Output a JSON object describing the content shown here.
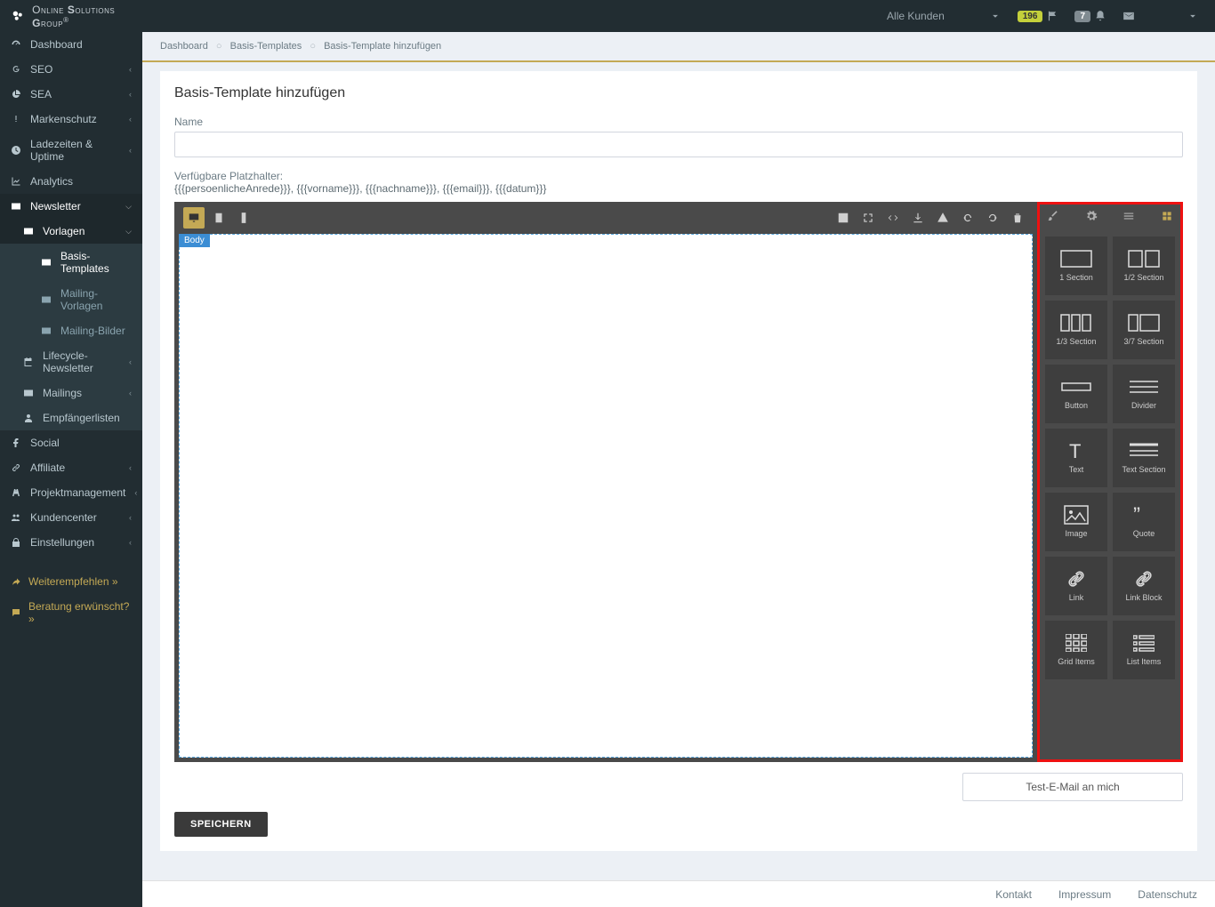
{
  "brand": {
    "name_html": "Online Solutions Group",
    "sup": "®"
  },
  "topbar": {
    "customer_label": "Alle Kunden",
    "badge1": "196",
    "badge2": "7"
  },
  "sidebar": {
    "items": [
      {
        "icon": "tach",
        "label": "Dashboard"
      },
      {
        "icon": "g",
        "label": "SEO",
        "chev": true
      },
      {
        "icon": "pie",
        "label": "SEA",
        "chev": true
      },
      {
        "icon": "excl",
        "label": "Markenschutz",
        "chev": true
      },
      {
        "icon": "clock",
        "label": "Ladezeiten & Uptime",
        "chev": true
      },
      {
        "icon": "chart",
        "label": "Analytics"
      },
      {
        "icon": "mail",
        "label": "Newsletter",
        "chev": true,
        "open": true
      },
      {
        "icon": "fb",
        "label": "Social"
      },
      {
        "icon": "link",
        "label": "Affiliate",
        "chev": true
      },
      {
        "icon": "road",
        "label": "Projektmanagement",
        "chev": true
      },
      {
        "icon": "users",
        "label": "Kundencenter",
        "chev": true
      },
      {
        "icon": "lock",
        "label": "Einstellungen",
        "chev": true
      }
    ],
    "newsletter_sub": [
      {
        "icon": "mail",
        "label": "Vorlagen",
        "chev": true,
        "open": true
      },
      {
        "icon": "cal",
        "label": "Lifecycle-Newsletter",
        "chev": true
      },
      {
        "icon": "mail",
        "label": "Mailings",
        "chev": true
      },
      {
        "icon": "user",
        "label": "Empfängerlisten"
      }
    ],
    "vorlagen_sub": [
      {
        "icon": "mail",
        "label": "Basis-Templates",
        "sel": true
      },
      {
        "icon": "mail",
        "label": "Mailing-Vorlagen"
      },
      {
        "icon": "mail",
        "label": "Mailing-Bilder"
      }
    ],
    "extra": [
      {
        "icon": "share",
        "label": "Weiterempfehlen »"
      },
      {
        "icon": "comment",
        "label": "Beratung erwünscht? »"
      }
    ]
  },
  "breadcrumb": [
    "Dashboard",
    "Basis-Templates",
    "Basis-Template hinzufügen"
  ],
  "page": {
    "title": "Basis-Template hinzufügen",
    "name_label": "Name",
    "placeholders_label": "Verfügbare Platzhalter:",
    "placeholders": "{{{persoenlicheAnrede}}}, {{{vorname}}}, {{{nachname}}}, {{{email}}}, {{{datum}}}",
    "body_tag": "Body",
    "test_btn": "Test-E-Mail an mich",
    "save_btn": "SPEICHERN"
  },
  "blocks": [
    {
      "label": "1 Section",
      "type": "sect1"
    },
    {
      "label": "1/2 Section",
      "type": "sect2"
    },
    {
      "label": "1/3 Section",
      "type": "sect3"
    },
    {
      "label": "3/7 Section",
      "type": "sect37"
    },
    {
      "label": "Button",
      "type": "button"
    },
    {
      "label": "Divider",
      "type": "divider"
    },
    {
      "label": "Text",
      "type": "text"
    },
    {
      "label": "Text Section",
      "type": "textsect"
    },
    {
      "label": "Image",
      "type": "image"
    },
    {
      "label": "Quote",
      "type": "quote"
    },
    {
      "label": "Link",
      "type": "link"
    },
    {
      "label": "Link Block",
      "type": "linkblock"
    },
    {
      "label": "Grid Items",
      "type": "grid"
    },
    {
      "label": "List Items",
      "type": "list"
    }
  ],
  "footer": {
    "kontakt": "Kontakt",
    "impressum": "Impressum",
    "datenschutz": "Datenschutz"
  }
}
